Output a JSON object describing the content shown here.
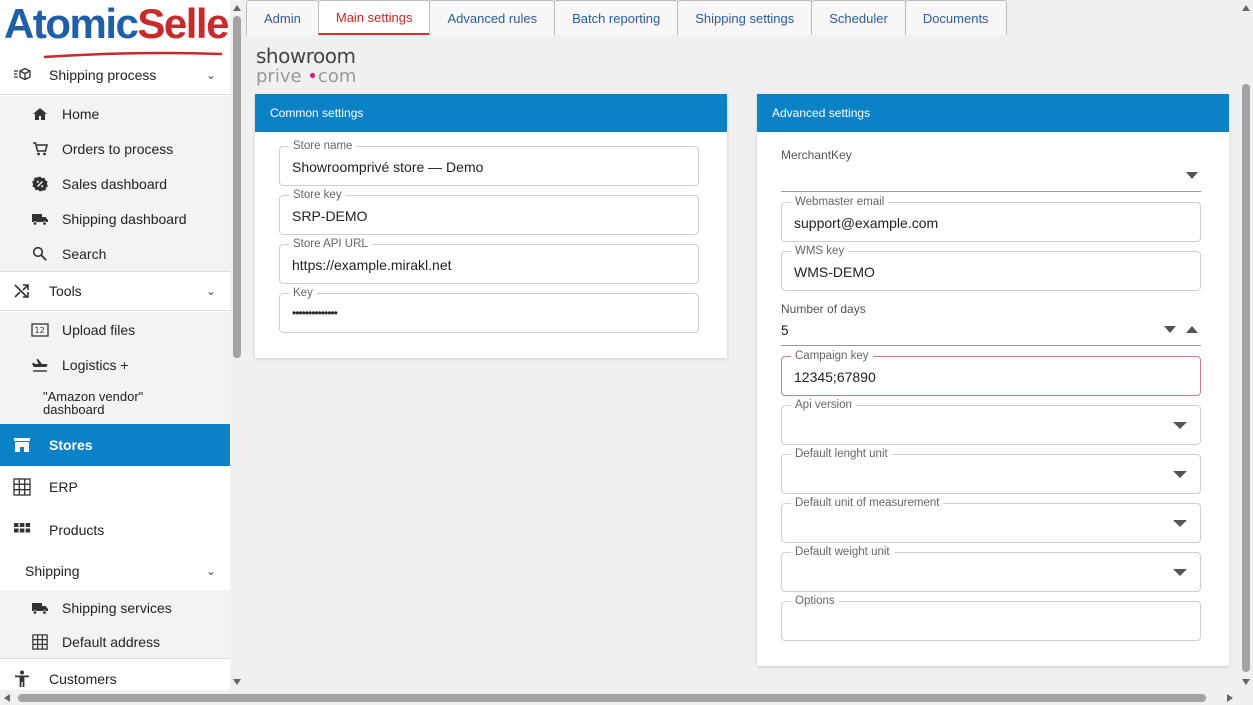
{
  "brand": {
    "name_part1": "Atomic",
    "name_part2": "Seller",
    "color_blue": "#1f5fa8",
    "color_red": "#c92a2a"
  },
  "sidebar": {
    "shipping_process": "Shipping process",
    "home": "Home",
    "orders_to_process": "Orders to process",
    "sales_dashboard": "Sales dashboard",
    "shipping_dashboard": "Shipping dashboard",
    "search": "Search",
    "tools": "Tools",
    "upload_files": "Upload files",
    "logistics": "Logistics +",
    "amazon_vendor_dashboard": "\"Amazon vendor\" dashboard",
    "stores": "Stores",
    "erp": "ERP",
    "products": "Products",
    "shipping": "Shipping",
    "shipping_services": "Shipping services",
    "default_address": "Default address",
    "customers": "Customers"
  },
  "tabs": [
    "Admin",
    "Main settings",
    "Advanced rules",
    "Batch reporting",
    "Shipping settings",
    "Scheduler",
    "Documents"
  ],
  "active_tab": "Main settings",
  "store_logo": {
    "line1": "showroom",
    "line2a": "prive",
    "line2b": "com"
  },
  "common_settings": {
    "title": "Common settings",
    "store_name_label": "Store name",
    "store_name_value": "Showroomprivé store — Demo",
    "store_key_label": "Store key",
    "store_key_value": "SRP-DEMO",
    "store_api_url_label": "Store API URL",
    "store_api_url_value": "https://example.mirakl.net",
    "key_label": "Key",
    "key_value": "••••••••••••••"
  },
  "advanced_settings": {
    "title": "Advanced settings",
    "merchant_key_label": "MerchantKey",
    "merchant_key_value": "",
    "webmaster_email_label": "Webmaster email",
    "webmaster_email_value": "support@example.com",
    "wms_key_label": "WMS key",
    "wms_key_value": "WMS-DEMO",
    "number_of_days_label": "Number of days",
    "number_of_days_value": "5",
    "campaign_key_label": "Campaign key",
    "campaign_key_value": "12345;67890",
    "api_version_label": "Api version",
    "default_length_unit_label": "Default lenght unit",
    "default_unit_measurement_label": "Default unit of measurement",
    "default_weight_unit_label": "Default weight unit",
    "options_label": "Options"
  },
  "colors": {
    "accent": "#0a82c5",
    "active_tab": "#c62828"
  }
}
